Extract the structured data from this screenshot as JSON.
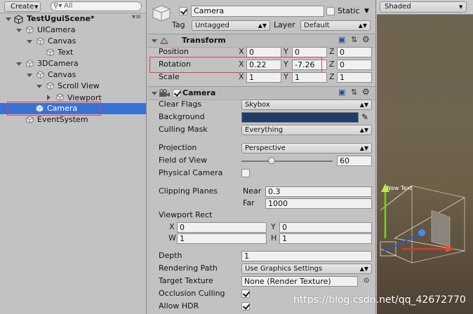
{
  "hierarchy": {
    "create_label": "Create",
    "search_placeholder": "All",
    "scene_name": "TestUguiScene*",
    "items": [
      {
        "label": "UICamera"
      },
      {
        "label": "Canvas"
      },
      {
        "label": "Text"
      },
      {
        "label": "3DCamera"
      },
      {
        "label": "Canvas"
      },
      {
        "label": "Scroll View"
      },
      {
        "label": "Viewport"
      },
      {
        "label": "Camera",
        "selected": true
      },
      {
        "label": "EventSystem"
      }
    ]
  },
  "inspector": {
    "object_name": "Camera",
    "static_label": "Static",
    "tag_label": "Tag",
    "tag_value": "Untagged",
    "layer_label": "Layer",
    "layer_value": "Default",
    "transform": {
      "title": "Transform",
      "position_label": "Position",
      "rotation_label": "Rotation",
      "scale_label": "Scale",
      "axis_x": "X",
      "axis_y": "Y",
      "axis_z": "Z",
      "position": {
        "x": "0",
        "y": "0",
        "z": "0"
      },
      "rotation": {
        "x": "0.22",
        "y": "-7.26",
        "z": "0"
      },
      "scale": {
        "x": "1",
        "y": "1",
        "z": "1"
      }
    },
    "camera": {
      "title": "Camera",
      "clear_flags_label": "Clear Flags",
      "clear_flags_value": "Skybox",
      "background_label": "Background",
      "background_color": "#1f3c66",
      "culling_mask_label": "Culling Mask",
      "culling_mask_value": "Everything",
      "projection_label": "Projection",
      "projection_value": "Perspective",
      "fov_label": "Field of View",
      "fov_value": "60",
      "fov_slider_fraction": 0.33,
      "physical_camera_label": "Physical Camera",
      "clipping_label": "Clipping Planes",
      "near_label": "Near",
      "near_value": "0.3",
      "far_label": "Far",
      "far_value": "1000",
      "viewport_label": "Viewport Rect",
      "vp_x_label": "X",
      "vp_x": "0",
      "vp_y_label": "Y",
      "vp_y": "0",
      "vp_w_label": "W",
      "vp_w": "1",
      "vp_h_label": "H",
      "vp_h": "1",
      "depth_label": "Depth",
      "depth_value": "1",
      "rendering_path_label": "Rendering Path",
      "rendering_path_value": "Use Graphics Settings",
      "target_texture_label": "Target Texture",
      "target_texture_value": "None (Render Texture)",
      "occlusion_label": "Occlusion Culling",
      "hdr_label": "Allow HDR"
    }
  },
  "scene_view": {
    "shaded_label": "Shaded",
    "new_text_label": "New Text"
  },
  "watermark": "https://blog.csdn.net/qq_42672770"
}
